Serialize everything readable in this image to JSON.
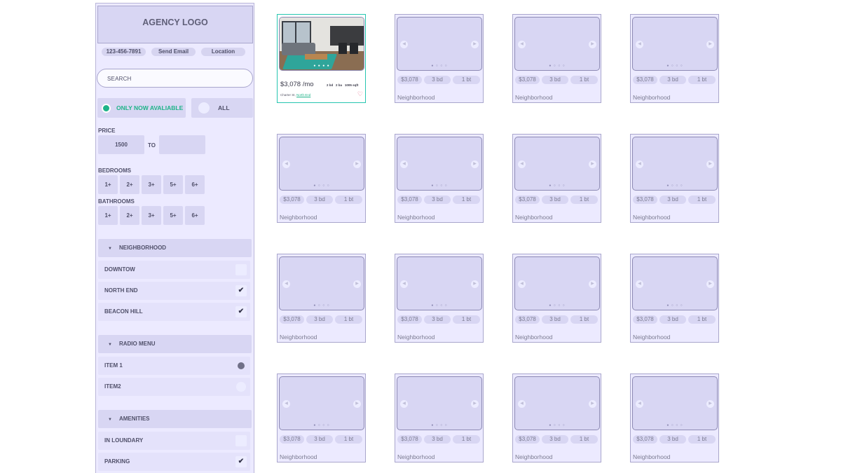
{
  "sidebar": {
    "logo": "AGENCY LOGO",
    "contacts": [
      "123-456-7891",
      "Send Email",
      "Location"
    ],
    "search_placeholder": "SEARCH",
    "availability": {
      "now_label": "ONLY NOW AVALIABLE",
      "all_label": "ALL",
      "selected": "now"
    },
    "price": {
      "label": "PRICE",
      "min": "1500",
      "to_label": "TO",
      "max": ""
    },
    "bedrooms": {
      "label": "BEDROOMS",
      "options": [
        "1+",
        "2+",
        "3+",
        "5+",
        "6+"
      ]
    },
    "bathrooms": {
      "label": "BATHROOMS",
      "options": [
        "1+",
        "2+",
        "3+",
        "5+",
        "6+"
      ]
    },
    "neighborhood": {
      "title": "NEIGHBORHOOD",
      "items": [
        {
          "label": "DOWNTOW",
          "checked": false
        },
        {
          "label": "NORTH END",
          "checked": true
        },
        {
          "label": "BEACON HILL",
          "checked": true
        }
      ]
    },
    "radio_menu": {
      "title": "RADIO MENU",
      "items": [
        {
          "label": "ITEM 1",
          "selected": true
        },
        {
          "label": "ITEM2",
          "selected": false
        }
      ]
    },
    "amenities": {
      "title": "AMENITIES",
      "items": [
        {
          "label": "IN LOUNDARY",
          "checked": false
        },
        {
          "label": "PARKING",
          "checked": true
        }
      ]
    }
  },
  "featured": {
    "price": "$3,078 /mo",
    "beds": "2 bd",
    "baths": "2 ba",
    "sqft": "1005 sqft",
    "address": "Charter St,",
    "neighborhood_link": "North End"
  },
  "placeholder_card": {
    "price": "$3,078",
    "beds": "3 bd",
    "baths": "1 bt",
    "neighborhood": "Neighborhood"
  }
}
